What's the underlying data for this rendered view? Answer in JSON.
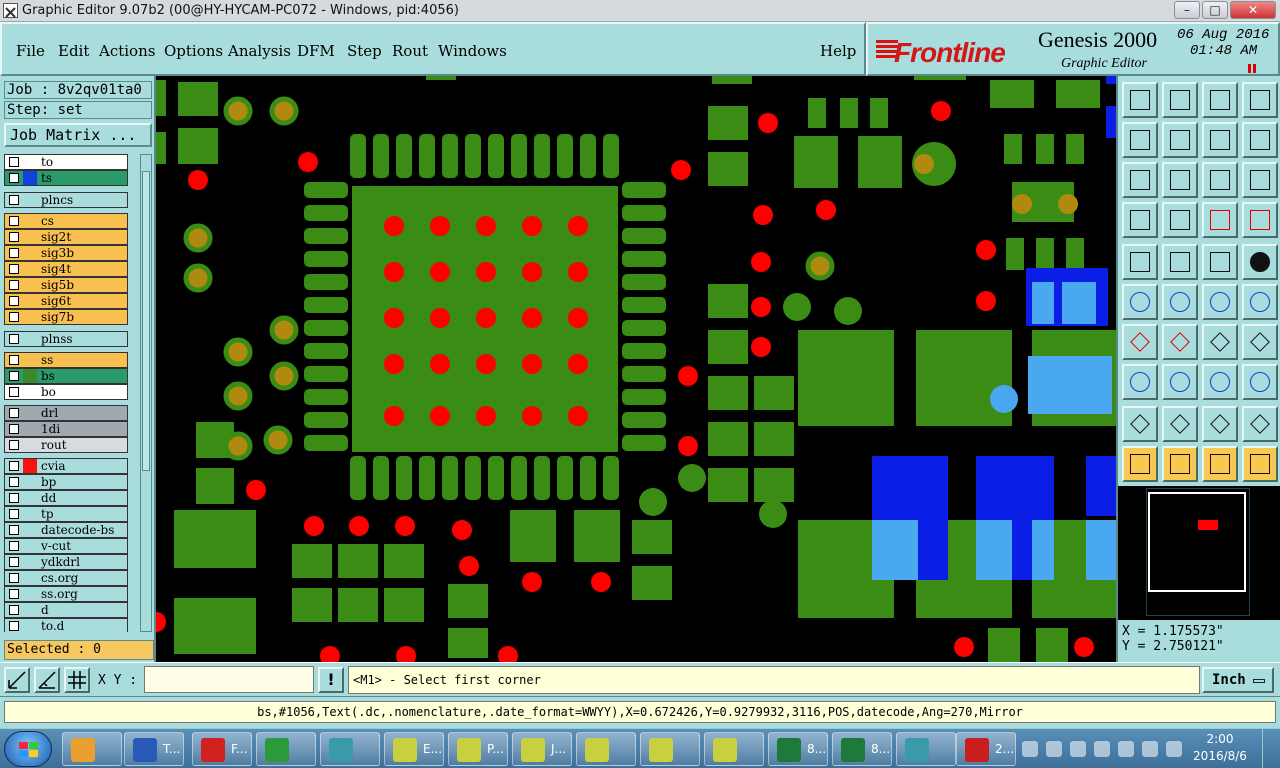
{
  "window": {
    "title": "Graphic Editor 9.07b2 (00@HY-HYCAM-PC072 - Windows, pid:4056)",
    "controls": [
      "–",
      "□",
      "✕"
    ]
  },
  "menu": [
    "File",
    "Edit",
    "Actions",
    "Options",
    "Analysis",
    "DFM",
    "Step",
    "Rout",
    "Windows",
    "Help"
  ],
  "brand": {
    "logo_text": "Frontline",
    "product": "Genesis 2000",
    "subtitle": "Graphic Editor",
    "date": "06 Aug 2016",
    "time": "01:48 AM"
  },
  "job": {
    "label": "Job : 8v2qv01ta0",
    "step": "Step: set",
    "matrix_button": "Job Matrix ..."
  },
  "layers": [
    {
      "name": "to",
      "bg": "#ffffff",
      "swatch": "#ffffff"
    },
    {
      "name": "ts",
      "bg": "#2a9a6a",
      "swatch": "#1040e0"
    },
    {
      "name": "plncs",
      "bg": "#a9dcdc",
      "swatch": "#a9dcdc"
    },
    {
      "name": "cs",
      "bg": "#f8c050",
      "swatch": "#f8c050"
    },
    {
      "name": "sig2t",
      "bg": "#f8c050",
      "swatch": "#f8c050"
    },
    {
      "name": "sig3b",
      "bg": "#f8c050",
      "swatch": "#f8c050"
    },
    {
      "name": "sig4t",
      "bg": "#f8c050",
      "swatch": "#f8c050"
    },
    {
      "name": "sig5b",
      "bg": "#f8c050",
      "swatch": "#f8c050"
    },
    {
      "name": "sig6t",
      "bg": "#f8c050",
      "swatch": "#f8c050"
    },
    {
      "name": "sig7b",
      "bg": "#f8c050",
      "swatch": "#f8c050"
    },
    {
      "name": "plnss",
      "bg": "#a9dcdc",
      "swatch": "#a9dcdc"
    },
    {
      "name": "ss",
      "bg": "#f8c050",
      "swatch": "#f8c050"
    },
    {
      "name": "bs",
      "bg": "#2a9a6a",
      "swatch": "#3a8a2a"
    },
    {
      "name": "bo",
      "bg": "#ffffff",
      "swatch": "#ffffff"
    },
    {
      "name": "drl",
      "bg": "#a0a8b0",
      "swatch": "#a0a8b0"
    },
    {
      "name": "1di",
      "bg": "#a0a8b0",
      "swatch": "#a0a8b0"
    },
    {
      "name": "rout",
      "bg": "#d8dce0",
      "swatch": "#d8dce0"
    },
    {
      "name": "cvia",
      "bg": "#a9dcdc",
      "swatch": "#ff1010"
    },
    {
      "name": "bp",
      "bg": "#a9dcdc",
      "swatch": "#a9dcdc"
    },
    {
      "name": "dd",
      "bg": "#a9dcdc",
      "swatch": "#a9dcdc"
    },
    {
      "name": "tp",
      "bg": "#a9dcdc",
      "swatch": "#a9dcdc"
    },
    {
      "name": "datecode-bs",
      "bg": "#a9dcdc",
      "swatch": "#a9dcdc"
    },
    {
      "name": "v-cut",
      "bg": "#a9dcdc",
      "swatch": "#a9dcdc"
    },
    {
      "name": "ydkdrl",
      "bg": "#a9dcdc",
      "swatch": "#a9dcdc"
    },
    {
      "name": "cs.org",
      "bg": "#a9dcdc",
      "swatch": "#a9dcdc"
    },
    {
      "name": "ss.org",
      "bg": "#a9dcdc",
      "swatch": "#a9dcdc"
    },
    {
      "name": "d",
      "bg": "#a9dcdc",
      "swatch": "#a9dcdc"
    },
    {
      "name": "to.d",
      "bg": "#a9dcdc",
      "swatch": "#a9dcdc"
    }
  ],
  "selected": "Selected : 0",
  "coords": {
    "x": "X = 1.175573\"",
    "y": "Y = 2.750121\""
  },
  "command": {
    "xy_label": "X Y :",
    "xy_value": "",
    "warn": "!",
    "prompt": "<M1> - Select first corner",
    "units": "Inch"
  },
  "status": "bs,#1056,Text(.dc,.nomenclature,.date_format=WWYY),X=0.672426,Y=0.9279932,3116,POS,datecode,Ang=270,Mirror",
  "taskbar": {
    "clock_time": "2:00",
    "clock_date": "2016/8/6",
    "buttons": [
      {
        "label": "",
        "icon": "shell-icon"
      },
      {
        "label": "T...",
        "icon": "floppy-icon"
      },
      {
        "label": "F...",
        "icon": "foxit-icon"
      },
      {
        "label": "",
        "icon": "genesis-icon"
      },
      {
        "label": "",
        "icon": "eye-icon"
      },
      {
        "label": "E...",
        "icon": "x-app-icon"
      },
      {
        "label": "P...",
        "icon": "x-app-icon"
      },
      {
        "label": "J...",
        "icon": "x-app-icon"
      },
      {
        "label": "",
        "icon": "x-app-icon"
      },
      {
        "label": "",
        "icon": "x-app-icon"
      },
      {
        "label": "",
        "icon": "x-app-icon"
      },
      {
        "label": "8...",
        "icon": "excel-icon"
      },
      {
        "label": "8...",
        "icon": "excel-icon"
      },
      {
        "label": "",
        "icon": "eye-icon"
      },
      {
        "label": "2...",
        "icon": "pdf-icon"
      }
    ]
  },
  "colors": {
    "panel": "#a9dcdc",
    "green": "#3a8c14",
    "red": "#ff0000",
    "blue": "#0a1ee6",
    "lightblue": "#4aa8f0",
    "yellow": "#f8c050"
  }
}
